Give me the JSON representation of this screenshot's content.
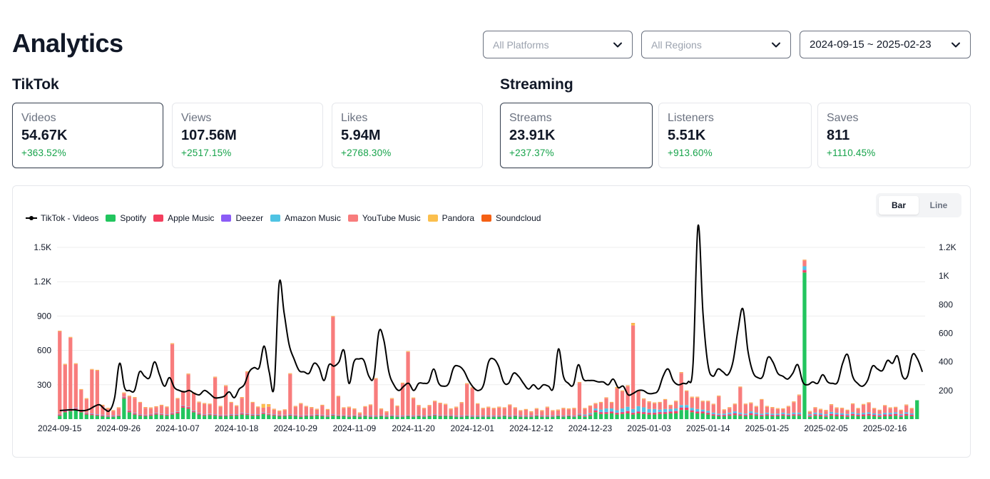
{
  "page": {
    "title": "Analytics"
  },
  "filters": {
    "platforms": "All Platforms",
    "regions": "All Regions",
    "date_range": "2024-09-15 ~ 2025-02-23"
  },
  "tiktok": {
    "title": "TikTok",
    "cards": [
      {
        "label": "Videos",
        "value": "54.67K",
        "change": "+363.52%"
      },
      {
        "label": "Views",
        "value": "107.56M",
        "change": "+2517.15%"
      },
      {
        "label": "Likes",
        "value": "5.94M",
        "change": "+2768.30%"
      }
    ]
  },
  "streaming": {
    "title": "Streaming",
    "cards": [
      {
        "label": "Streams",
        "value": "23.91K",
        "change": "+237.37%"
      },
      {
        "label": "Listeners",
        "value": "5.51K",
        "change": "+913.60%"
      },
      {
        "label": "Saves",
        "value": "811",
        "change": "+1110.45%"
      }
    ]
  },
  "chart_toggle": {
    "bar": "Bar",
    "line": "Line",
    "selected": "Bar"
  },
  "colors": {
    "spotify": "#22c55e",
    "apple": "#f43f5e",
    "deezer": "#8b5cf6",
    "amazon": "#4fc3e3",
    "youtube": "#f87c7c",
    "pandora": "#fbbf4d",
    "soundcloud": "#f56014",
    "tiktok": "#000000",
    "positive": "#16a34a"
  },
  "chart_data": {
    "type": "bar",
    "legend_position": "top-left",
    "legend": [
      "TikTok - Videos",
      "Spotify",
      "Apple Music",
      "Deezer",
      "Amazon Music",
      "YouTube Music",
      "Pandora",
      "Soundcloud"
    ],
    "x_tick_labels": [
      "2024-09-15",
      "2024-09-26",
      "2024-10-07",
      "2024-10-18",
      "2024-10-29",
      "2024-11-09",
      "2024-11-20",
      "2024-12-01",
      "2024-12-12",
      "2024-12-23",
      "2025-01-03",
      "2025-01-14",
      "2025-01-25",
      "2025-02-05",
      "2025-02-16"
    ],
    "x_start": "2024-09-15",
    "x_end": "2025-02-23",
    "y_left": {
      "ticks": [
        "1.5K",
        "1.2K",
        "900",
        "600",
        "300"
      ],
      "range": [
        0,
        1500
      ]
    },
    "y_right": {
      "ticks": [
        "1.2K",
        "1K",
        "800",
        "600",
        "400",
        "200"
      ],
      "range": [
        0,
        1200
      ]
    },
    "grid": true,
    "series_streams": {
      "spotify": [
        30,
        60,
        70,
        80,
        60,
        40,
        35,
        30,
        25,
        20,
        20,
        25,
        180,
        60,
        40,
        30,
        25,
        30,
        40,
        35,
        30,
        40,
        50,
        100,
        90,
        60,
        40,
        30,
        35,
        30,
        25,
        25,
        30,
        30,
        40,
        35,
        30,
        30,
        45,
        35,
        30,
        25,
        25,
        30,
        25,
        20,
        25,
        25,
        30,
        25,
        20,
        30,
        25,
        25,
        20,
        25,
        20,
        25,
        20,
        20,
        25,
        20,
        25,
        20,
        20,
        25,
        20,
        25,
        20,
        25,
        30,
        25,
        25,
        25,
        20,
        20,
        25,
        20,
        20,
        20,
        20,
        20,
        20,
        25,
        20,
        25,
        20,
        20,
        20,
        25,
        20,
        20,
        20,
        25,
        20,
        25,
        20,
        30,
        20,
        30,
        60,
        45,
        45,
        50,
        40,
        45,
        50,
        40,
        50,
        45,
        40,
        40,
        45,
        45,
        50,
        50,
        80,
        80,
        60,
        50,
        50,
        40,
        30,
        25,
        25,
        30,
        35,
        30,
        25,
        35,
        30,
        25,
        30,
        25,
        25,
        30,
        25,
        30,
        30,
        1280,
        20,
        30,
        25,
        20,
        30,
        25,
        25,
        20,
        30,
        25,
        25,
        30,
        25,
        20,
        25,
        25,
        30,
        20,
        30,
        25,
        165
      ],
      "apple": [
        10,
        10,
        15,
        15,
        10,
        10,
        10,
        8,
        8,
        6,
        6,
        6,
        10,
        12,
        10,
        8,
        8,
        10,
        10,
        8,
        8,
        10,
        12,
        15,
        15,
        10,
        10,
        8,
        8,
        8,
        8,
        8,
        8,
        8,
        10,
        10,
        8,
        8,
        10,
        8,
        8,
        8,
        8,
        8,
        8,
        8,
        8,
        8,
        8,
        8,
        6,
        8,
        6,
        6,
        6,
        6,
        6,
        6,
        6,
        6,
        6,
        6,
        6,
        6,
        6,
        6,
        6,
        6,
        6,
        6,
        8,
        6,
        6,
        6,
        6,
        6,
        6,
        6,
        6,
        6,
        6,
        6,
        6,
        6,
        6,
        6,
        6,
        6,
        6,
        8,
        6,
        6,
        6,
        6,
        6,
        6,
        6,
        10,
        8,
        10,
        15,
        15,
        15,
        15,
        15,
        15,
        20,
        15,
        15,
        15,
        15,
        15,
        15,
        15,
        15,
        20,
        20,
        20,
        15,
        15,
        15,
        15,
        12,
        10,
        10,
        12,
        15,
        12,
        10,
        15,
        12,
        10,
        12,
        10,
        10,
        12,
        10,
        12,
        12,
        20,
        10,
        12,
        12,
        10,
        15,
        15,
        12,
        12,
        15,
        12,
        15,
        15,
        12,
        12,
        15,
        15,
        15,
        12,
        15,
        12,
        0
      ],
      "deezer": [
        2,
        2,
        2,
        2,
        2,
        2,
        2,
        2,
        2,
        2,
        2,
        2,
        2,
        2,
        2,
        2,
        2,
        2,
        2,
        2,
        2,
        2,
        2,
        2,
        2,
        2,
        2,
        2,
        2,
        2,
        2,
        2,
        2,
        2,
        2,
        2,
        2,
        2,
        2,
        2,
        2,
        2,
        2,
        2,
        2,
        2,
        2,
        2,
        2,
        2,
        2,
        2,
        2,
        2,
        2,
        2,
        2,
        2,
        2,
        2,
        2,
        2,
        2,
        2,
        2,
        2,
        2,
        2,
        2,
        2,
        2,
        2,
        2,
        2,
        2,
        2,
        2,
        2,
        2,
        2,
        2,
        2,
        2,
        2,
        2,
        2,
        2,
        2,
        2,
        2,
        2,
        2,
        2,
        2,
        2,
        2,
        2,
        2,
        2,
        2,
        3,
        3,
        3,
        3,
        3,
        3,
        3,
        3,
        3,
        3,
        3,
        3,
        3,
        3,
        3,
        3,
        3,
        3,
        3,
        3,
        3,
        3,
        3,
        3,
        3,
        3,
        3,
        3,
        3,
        3,
        3,
        3,
        3,
        3,
        3,
        3,
        3,
        3,
        3,
        5,
        3,
        3,
        3,
        3,
        3,
        3,
        3,
        3,
        3,
        3,
        3,
        3,
        3,
        3,
        3,
        3,
        3,
        3,
        3,
        3,
        0
      ],
      "amazon": [
        3,
        3,
        3,
        3,
        3,
        3,
        3,
        3,
        3,
        3,
        3,
        3,
        3,
        3,
        3,
        3,
        3,
        3,
        3,
        3,
        3,
        3,
        3,
        3,
        3,
        3,
        3,
        3,
        3,
        3,
        3,
        3,
        3,
        3,
        3,
        3,
        3,
        3,
        3,
        3,
        3,
        3,
        3,
        3,
        3,
        3,
        3,
        3,
        3,
        3,
        3,
        3,
        3,
        3,
        3,
        3,
        3,
        3,
        3,
        3,
        3,
        3,
        3,
        3,
        3,
        3,
        3,
        3,
        3,
        3,
        3,
        3,
        3,
        3,
        3,
        3,
        3,
        3,
        3,
        3,
        3,
        3,
        3,
        3,
        3,
        3,
        3,
        3,
        3,
        3,
        3,
        3,
        3,
        3,
        3,
        3,
        3,
        5,
        10,
        10,
        15,
        20,
        30,
        25,
        20,
        30,
        35,
        30,
        45,
        40,
        30,
        30,
        20,
        25,
        20,
        20,
        20,
        20,
        20,
        20,
        15,
        15,
        12,
        10,
        10,
        12,
        15,
        12,
        10,
        15,
        12,
        10,
        12,
        10,
        10,
        12,
        10,
        12,
        12,
        30,
        10,
        12,
        12,
        10,
        15,
        12,
        12,
        10,
        12,
        10,
        12,
        12,
        10,
        10,
        12,
        12,
        12,
        10,
        12,
        10,
        0
      ],
      "youtube": [
        720,
        400,
        620,
        380,
        180,
        120,
        380,
        380,
        80,
        60,
        40,
        60,
        30,
        120,
        130,
        100,
        60,
        50,
        50,
        70,
        60,
        600,
        110,
        120,
        280,
        150,
        90,
        90,
        80,
        320,
        70,
        250,
        100,
        70,
        130,
        360,
        100,
        60,
        40,
        60,
        40,
        30,
        40,
        350,
        70,
        100,
        70,
        60,
        40,
        80,
        50,
        850,
        160,
        60,
        70,
        50,
        20,
        70,
        90,
        320,
        50,
        30,
        140,
        80,
        280,
        550,
        150,
        80,
        60,
        80,
        110,
        100,
        90,
        50,
        70,
        110,
        270,
        240,
        100,
        60,
        70,
        60,
        70,
        60,
        90,
        60,
        40,
        50,
        30,
        50,
        40,
        70,
        40,
        40,
        60,
        50,
        60,
        270,
        50,
        60,
        40,
        60,
        90,
        50,
        190,
        150,
        180,
        730,
        130,
        70,
        60,
        50,
        60,
        80,
        30,
        60,
        280,
        120,
        90,
        100,
        70,
        80,
        70,
        150,
        30,
        40,
        60,
        220,
        80,
        70,
        50,
        120,
        50,
        50,
        40,
        30,
        60,
        90,
        150,
        50,
        20,
        40,
        30,
        30,
        60,
        40,
        40,
        30,
        70,
        40,
        70,
        80,
        40,
        30,
        60,
        40,
        40,
        30,
        60,
        40,
        0
      ],
      "pandora": [
        5,
        5,
        5,
        5,
        5,
        5,
        5,
        5,
        5,
        5,
        5,
        5,
        5,
        5,
        5,
        5,
        5,
        5,
        5,
        5,
        5,
        5,
        5,
        5,
        5,
        5,
        5,
        5,
        5,
        5,
        5,
        5,
        5,
        5,
        5,
        5,
        5,
        5,
        30,
        20,
        5,
        5,
        5,
        5,
        5,
        5,
        5,
        5,
        5,
        5,
        5,
        5,
        5,
        5,
        5,
        5,
        5,
        5,
        5,
        5,
        5,
        5,
        5,
        5,
        5,
        5,
        5,
        5,
        5,
        5,
        5,
        5,
        5,
        5,
        5,
        5,
        5,
        5,
        5,
        5,
        5,
        5,
        5,
        5,
        5,
        5,
        5,
        5,
        5,
        5,
        5,
        5,
        5,
        5,
        5,
        5,
        5,
        5,
        5,
        5,
        5,
        5,
        5,
        5,
        10,
        5,
        5,
        20,
        5,
        5,
        5,
        5,
        5,
        5,
        5,
        5,
        5,
        5,
        5,
        5,
        5,
        5,
        5,
        5,
        5,
        5,
        5,
        5,
        5,
        5,
        5,
        5,
        5,
        5,
        5,
        5,
        5,
        5,
        5,
        5,
        5,
        5,
        5,
        5,
        5,
        5,
        5,
        5,
        5,
        5,
        5,
        5,
        5,
        5,
        5,
        5,
        5,
        5,
        5,
        5,
        0
      ],
      "soundcloud": [
        2,
        2,
        2,
        2,
        2,
        2,
        2,
        2,
        2,
        2,
        2,
        2,
        2,
        2,
        2,
        2,
        2,
        2,
        2,
        2,
        2,
        2,
        2,
        2,
        2,
        2,
        2,
        2,
        2,
        2,
        2,
        2,
        2,
        2,
        2,
        2,
        2,
        2,
        2,
        2,
        2,
        2,
        2,
        2,
        2,
        2,
        2,
        2,
        2,
        2,
        2,
        2,
        2,
        2,
        2,
        2,
        2,
        2,
        2,
        2,
        2,
        2,
        2,
        2,
        2,
        2,
        2,
        2,
        2,
        2,
        2,
        2,
        2,
        2,
        2,
        2,
        2,
        2,
        2,
        2,
        2,
        2,
        2,
        2,
        2,
        2,
        2,
        2,
        2,
        2,
        2,
        2,
        2,
        2,
        2,
        2,
        2,
        2,
        2,
        2,
        2,
        2,
        2,
        2,
        2,
        2,
        2,
        2,
        2,
        2,
        2,
        2,
        2,
        2,
        2,
        2,
        2,
        2,
        2,
        2,
        2,
        2,
        2,
        2,
        2,
        2,
        2,
        2,
        2,
        2,
        2,
        2,
        2,
        2,
        2,
        2,
        2,
        2,
        2,
        2,
        2,
        2,
        2,
        2,
        2,
        2,
        2,
        2,
        2,
        2,
        2,
        2,
        2,
        2,
        2,
        2,
        2,
        2,
        2,
        2,
        0
      ]
    },
    "series_tiktok_videos": [
      60,
      62,
      65,
      65,
      60,
      60,
      70,
      90,
      100,
      70,
      60,
      150,
      390,
      220,
      200,
      200,
      330,
      300,
      290,
      400,
      310,
      230,
      290,
      220,
      200,
      190,
      200,
      180,
      170,
      200,
      180,
      150,
      150,
      160,
      190,
      150,
      210,
      240,
      330,
      360,
      360,
      510,
      330,
      230,
      950,
      740,
      520,
      420,
      340,
      330,
      320,
      390,
      360,
      270,
      380,
      370,
      400,
      480,
      250,
      400,
      420,
      410,
      300,
      300,
      610,
      550,
      330,
      240,
      200,
      230,
      250,
      200,
      250,
      250,
      260,
      350,
      250,
      230,
      250,
      360,
      370,
      340,
      270,
      220,
      200,
      240,
      400,
      420,
      370,
      260,
      250,
      320,
      300,
      250,
      210,
      240,
      210,
      240,
      230,
      220,
      490,
      300,
      250,
      240,
      380,
      280,
      270,
      270,
      260,
      260,
      240,
      280,
      220,
      230,
      170,
      180,
      200,
      200,
      180,
      180,
      200,
      300,
      350,
      270,
      240,
      250,
      260,
      380,
      1350,
      740,
      380,
      300,
      350,
      330,
      310,
      400,
      620,
      770,
      480,
      330,
      290,
      300,
      430,
      400,
      320,
      300,
      280,
      320,
      380,
      260,
      240,
      260,
      250,
      310,
      260,
      250,
      260,
      390,
      450,
      300,
      250,
      230,
      270,
      370,
      350,
      340,
      410,
      390,
      440,
      300,
      300,
      450,
      420,
      330
    ]
  }
}
